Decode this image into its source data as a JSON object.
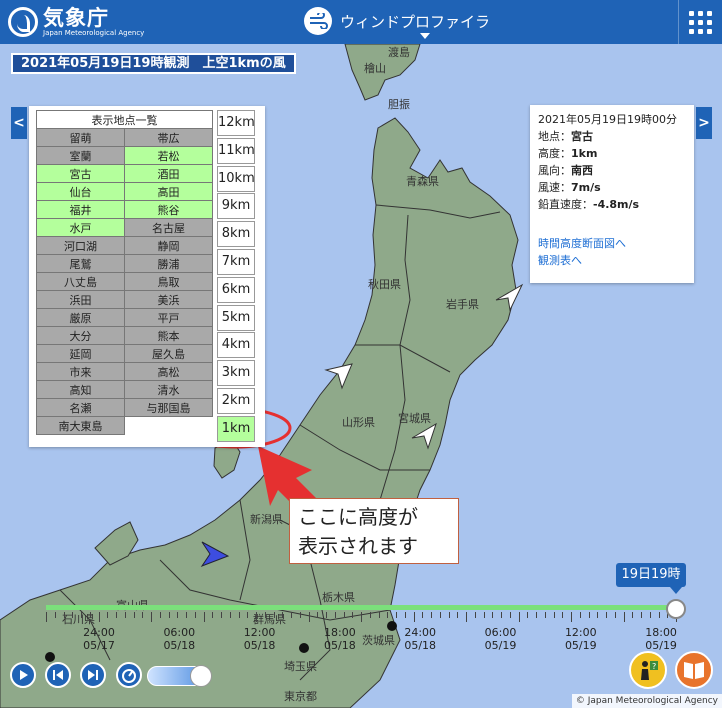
{
  "header": {
    "logo_text": "気象庁",
    "logo_subtext": "Japan Meteorological Agency",
    "app_title": "ウィンドプロファイラ"
  },
  "observation": {
    "label": "2021年05月19日19時観測　上空1kmの風"
  },
  "stations": {
    "title": "表示地点一覧",
    "rows": [
      [
        {
          "name": "留萌",
          "active": false
        },
        {
          "name": "帯広",
          "active": false
        }
      ],
      [
        {
          "name": "室蘭",
          "active": false
        },
        {
          "name": "若松",
          "active": true
        }
      ],
      [
        {
          "name": "宮古",
          "active": true
        },
        {
          "name": "酒田",
          "active": true
        }
      ],
      [
        {
          "name": "仙台",
          "active": true
        },
        {
          "name": "高田",
          "active": true
        }
      ],
      [
        {
          "name": "福井",
          "active": true
        },
        {
          "name": "熊谷",
          "active": true
        }
      ],
      [
        {
          "name": "水戸",
          "active": true
        },
        {
          "name": "名古屋",
          "active": false
        }
      ],
      [
        {
          "name": "河口湖",
          "active": false
        },
        {
          "name": "静岡",
          "active": false
        }
      ],
      [
        {
          "name": "尾鷲",
          "active": false
        },
        {
          "name": "勝浦",
          "active": false
        }
      ],
      [
        {
          "name": "八丈島",
          "active": false
        },
        {
          "name": "鳥取",
          "active": false
        }
      ],
      [
        {
          "name": "浜田",
          "active": false
        },
        {
          "name": "美浜",
          "active": false
        }
      ],
      [
        {
          "name": "厳原",
          "active": false
        },
        {
          "name": "平戸",
          "active": false
        }
      ],
      [
        {
          "name": "大分",
          "active": false
        },
        {
          "name": "熊本",
          "active": false
        }
      ],
      [
        {
          "name": "延岡",
          "active": false
        },
        {
          "name": "屋久島",
          "active": false
        }
      ],
      [
        {
          "name": "市来",
          "active": false
        },
        {
          "name": "高松",
          "active": false
        }
      ],
      [
        {
          "name": "高知",
          "active": false
        },
        {
          "name": "清水",
          "active": false
        }
      ],
      [
        {
          "name": "名瀬",
          "active": false
        },
        {
          "name": "与那国島",
          "active": false
        }
      ],
      [
        {
          "name": "南大東島",
          "active": false
        }
      ]
    ]
  },
  "altitudes": {
    "items": [
      "12km",
      "11km",
      "10km",
      "9km",
      "8km",
      "7km",
      "6km",
      "5km",
      "4km",
      "3km",
      "2km",
      "1km"
    ],
    "selected": "1km"
  },
  "info": {
    "datetime": "2021年05月19日19時00分",
    "rows": [
      {
        "label": "地点：",
        "value": "宮古"
      },
      {
        "label": "高度：",
        "value": "1km"
      },
      {
        "label": "風向：",
        "value": "南西"
      },
      {
        "label": "風速：",
        "value": "7m/s"
      },
      {
        "label": "鉛直速度：",
        "value": "-4.8m/s"
      }
    ],
    "links": [
      "時間高度断面図へ",
      "観測表へ"
    ]
  },
  "callout": {
    "line1": "ここに高度が",
    "line2": "表示されます"
  },
  "map_labels": {
    "prefectures": [
      "青森県",
      "秋田県",
      "岩手県",
      "山形県",
      "宮城県",
      "新潟県",
      "栃木県",
      "富山県",
      "群馬県",
      "茨城県",
      "埼玉県",
      "東京都",
      "石川県"
    ],
    "cities": [
      "渡島",
      "檜山",
      "胆振"
    ]
  },
  "timeline": {
    "current": "19日19時",
    "labels": [
      {
        "time": "24:00",
        "date": "05/17"
      },
      {
        "time": "06:00",
        "date": "05/18"
      },
      {
        "time": "12:00",
        "date": "05/18"
      },
      {
        "time": "18:00",
        "date": "05/18"
      },
      {
        "time": "24:00",
        "date": "05/18"
      },
      {
        "time": "06:00",
        "date": "05/19"
      },
      {
        "time": "12:00",
        "date": "05/19"
      },
      {
        "time": "18:00",
        "date": "05/19"
      }
    ]
  },
  "controls": {
    "play_icon": "play-icon",
    "prev_icon": "step-back-icon",
    "next_icon": "step-forward-icon",
    "speed_icon": "speed-gauge-icon",
    "help_icon": "help-person-icon",
    "manual_icon": "book-icon"
  },
  "copyright": "© Japan Meteorological Agency",
  "colors": {
    "brand": "#1f63b6",
    "sea": "#a9c4ee",
    "land": "#8fa98a",
    "active_station": "#b4ff9c",
    "inactive_station": "#a9a9a9",
    "highlight": "#e53030"
  }
}
